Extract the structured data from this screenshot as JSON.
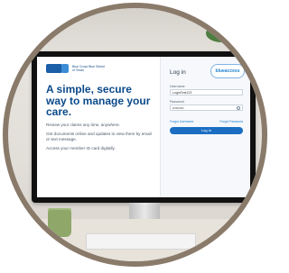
{
  "brand": {
    "logo_text": "Blue Cross Blue Shield of Texas",
    "primary_color": "#0b4a8a",
    "accent_color": "#1b6ec2"
  },
  "hero": {
    "headline": "A simple, secure way to manage your care.",
    "paragraphs": [
      "Review your claims any time, anywhere.",
      "Get documents online and updates to view them by email or text message.",
      "Access your member ID card digitally."
    ]
  },
  "login": {
    "title": "Log in",
    "badge": "blueaccess",
    "username_label": "Username",
    "username_value": "LoginTest123",
    "password_label": "Password",
    "password_value": "••••••••••",
    "forgot_username": "Forgot Username",
    "forgot_password": "Forgot Password",
    "login_button": "Log In"
  },
  "icons": {
    "password_toggle": "eye-icon",
    "logo": "bcbs-logo-icon"
  }
}
